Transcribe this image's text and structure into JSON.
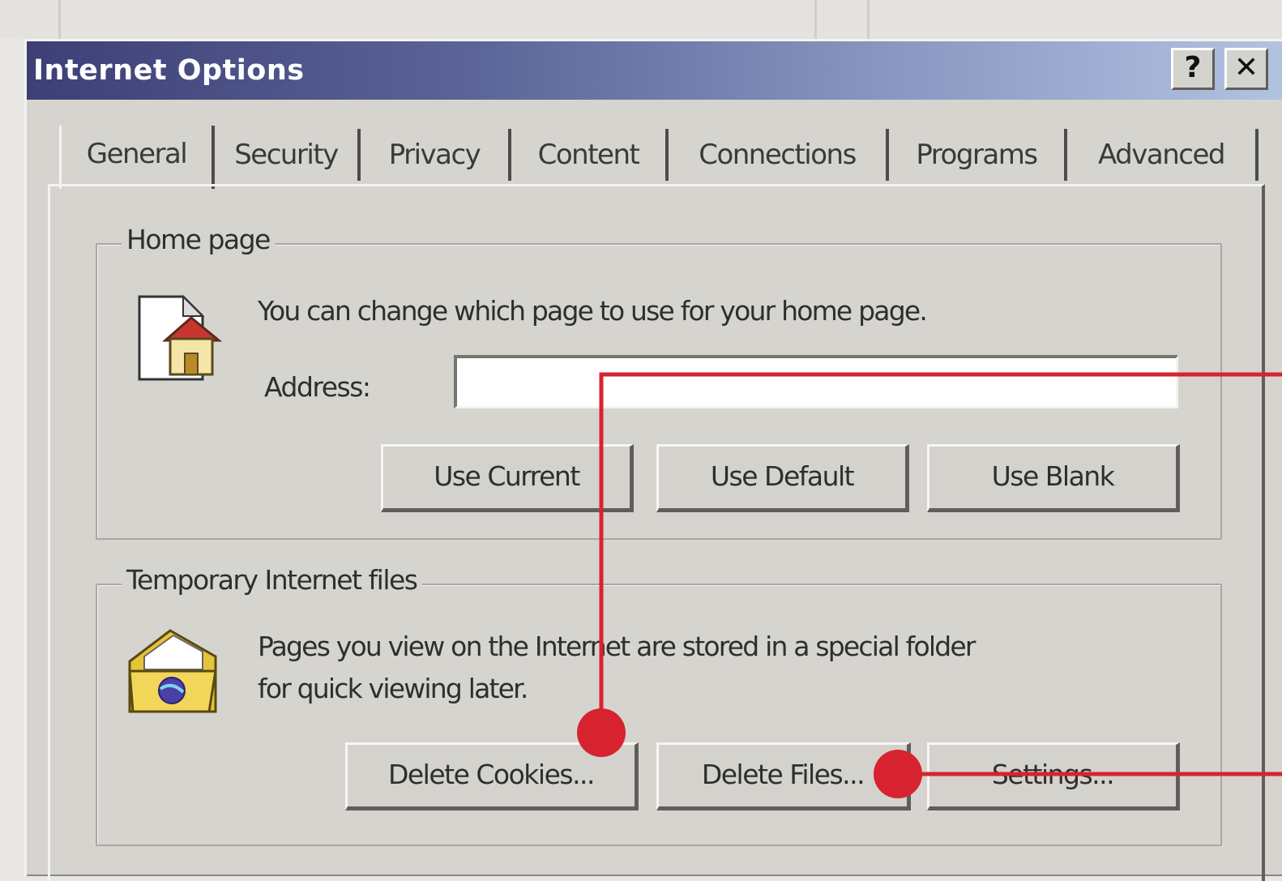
{
  "window": {
    "title": "Internet Options",
    "help_glyph": "?",
    "close_glyph": "✕"
  },
  "tabs": [
    {
      "label": "General",
      "active": true
    },
    {
      "label": "Security",
      "active": false
    },
    {
      "label": "Privacy",
      "active": false
    },
    {
      "label": "Content",
      "active": false
    },
    {
      "label": "Connections",
      "active": false
    },
    {
      "label": "Programs",
      "active": false
    },
    {
      "label": "Advanced",
      "active": false
    }
  ],
  "home_page": {
    "legend": "Home page",
    "description": "You can change which page to use for your home page.",
    "address_label": "Address:",
    "address_value": "",
    "buttons": {
      "use_current": "Use Current",
      "use_default": "Use Default",
      "use_blank": "Use Blank"
    }
  },
  "temp_files": {
    "legend": "Temporary Internet files",
    "description_line1": "Pages you view on the Internet are stored in a special folder",
    "description_line2": "for quick viewing later.",
    "buttons": {
      "delete_cookies": "Delete Cookies...",
      "delete_files": "Delete Files...",
      "settings": "Settings..."
    }
  },
  "icons": {
    "home_page": "home-page-icon",
    "temp_files": "temp-internet-files-folder-icon",
    "help": "help-icon",
    "close": "close-icon"
  },
  "colors": {
    "titlebar_start": "#3d3f76",
    "titlebar_end": "#b3c3e2",
    "dialog_face": "#d6d4cf",
    "callout_red": "#d7232f"
  }
}
